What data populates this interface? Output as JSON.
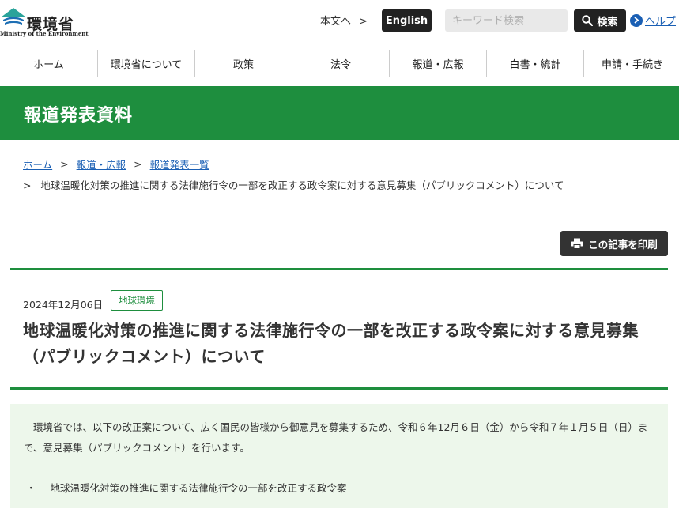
{
  "header": {
    "logo_jp": "環境省",
    "logo_en": "Ministry of the Environment",
    "skip_link": "本文へ",
    "english_label": "English",
    "search_placeholder": "キーワード検索",
    "search_button": "検索",
    "help_label": "ヘルプ"
  },
  "nav": {
    "items": [
      "ホーム",
      "環境省について",
      "政策",
      "法令",
      "報道・広報",
      "白書・統計",
      "申請・手続き"
    ]
  },
  "page_title": "報道発表資料",
  "breadcrumb": {
    "items": [
      "ホーム",
      "報道・広報",
      "報道発表一覧"
    ],
    "separator": ">",
    "current": "地球温暖化対策の推進に関する法律施行令の一部を改正する政令案に対する意見募集（パブリックコメント）について"
  },
  "print_button": "この記事を印刷",
  "article": {
    "date": "2024年12月06日",
    "tag": "地球環境",
    "title": "地球温暖化対策の推進に関する法律施行令の一部を改正する政令案に対する意見募集（パブリックコメント）について",
    "body": "環境省では、以下の改正案について、広く国民の皆様から御意見を募集するため、令和６年12月６日（金）から令和７年１月５日（日）まで、意見募集（パブリックコメント）を行います。",
    "bullet_mark": "・",
    "bullet": "地球温暖化対策の推進に関する法律施行令の一部を改正する政令案"
  },
  "colors": {
    "brand_green": "#1e8e3e",
    "link_blue": "#1a5fb4",
    "dark_button": "#222222",
    "body_box_bg": "#edf7eb"
  }
}
